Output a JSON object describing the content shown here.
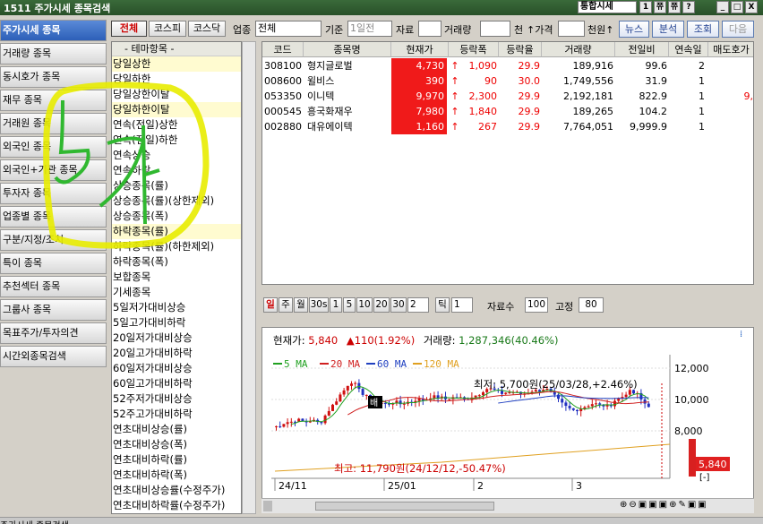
{
  "titlebar": {
    "title": "1511 주가시세 종목검색",
    "combo": "통합시세",
    "b1": "1",
    "b2": "쮸",
    "b3": "?",
    "b4": "_",
    "b5": "□",
    "b6": "X"
  },
  "leftmenu": [
    "주가시세 종목",
    "거래량 종목",
    "동시호가 종목",
    "재무 종목",
    "거래원 종목",
    "외국인 종목",
    "외국인+기관 종목",
    "투자자 종목",
    "업종별 종목",
    "구분/지정/조치",
    "특이 종목",
    "추천섹터 종목",
    "그룹사 종목",
    "목표주가/투자의견",
    "시간외종목검색"
  ],
  "toolbar": {
    "market_all": "전체",
    "kospi": "코스피",
    "kosdaq": "코스닥",
    "sector_label": "업종",
    "sector_value": "전체",
    "base_label": "기준",
    "base_value": "1일전",
    "data_label": "자료",
    "volume_label": "거래량",
    "unit_thousand": "천",
    "price_label": "↑가격",
    "unit_won": "천원↑",
    "news": "뉴스",
    "analysis": "분석",
    "search": "조회",
    "next": "다음"
  },
  "themes": {
    "header": "-   테마항목   -",
    "items": [
      "당일상한",
      "당일하한",
      "당일상한이탈",
      "당일하한이탈",
      "연속(전일)상한",
      "연속(전일)하한",
      "연속상승",
      "연속하락",
      "상승종목(률)",
      "상승종목(률)(상한제외)",
      "상승종목(폭)",
      "하락종목(률)",
      "하락종목(률)(하한제외)",
      "하락종목(폭)",
      "보합종목",
      "기세종목",
      "5일저가대비상승",
      "5일고가대비하락",
      "20일저가대비상승",
      "20일고가대비하락",
      "60일저가대비상승",
      "60일고가대비하락",
      "52주저가대비상승",
      "52주고가대비하락",
      "연초대비상승(률)",
      "연초대비상승(폭)",
      "연초대비하락(률)",
      "연초대비하락(폭)",
      "연초대비상승률(수정주가)",
      "연초대비하락률(수정주가)"
    ]
  },
  "grid": {
    "headers": [
      "코드",
      "종목명",
      "현재가",
      "등락폭",
      "등락율",
      "거래량",
      "전일비",
      "연속일",
      "매도호가"
    ],
    "rows": [
      [
        "308100",
        "형지글로벌",
        "4,730",
        "↑",
        "1,090",
        "29.9",
        "189,916",
        "99.6",
        "2",
        ""
      ],
      [
        "008600",
        "윌비스",
        "390",
        "↑",
        "90",
        "30.0",
        "1,749,556",
        "31.9",
        "1",
        ""
      ],
      [
        "053350",
        "이니텍",
        "9,970",
        "↑",
        "2,300",
        "29.9",
        "2,192,181",
        "822.9",
        "1",
        "9,"
      ],
      [
        "000545",
        "흥국화재우",
        "7,980",
        "↑",
        "1,840",
        "29.9",
        "189,265",
        "104.2",
        "1",
        ""
      ],
      [
        "002880",
        "대유에이텍",
        "1,160",
        "↑",
        "267",
        "29.9",
        "7,764,051",
        "9,999.9",
        "1",
        ""
      ]
    ]
  },
  "chartbar": {
    "periods": [
      "일",
      "주",
      "월",
      "30s",
      "1",
      "5",
      "10",
      "20",
      "30"
    ],
    "period_input": "2",
    "tick_label": "틱",
    "tick_value": "1",
    "count_label": "자료수",
    "count_value": "100",
    "fixed_label": "고정",
    "fixed_value": "80"
  },
  "chart": {
    "current_label": "현재가:",
    "current_value": "5,840",
    "change": "▲110(1.92%)",
    "volume_label": "거래량:",
    "volume_value": "1,287,346(40.46%)",
    "ma": [
      "5 MA",
      "20 MA",
      "60 MA",
      "120 MA"
    ],
    "ma_colors": [
      "#20a020",
      "#d02020",
      "#2040c0",
      "#e0a020"
    ],
    "low_note": "최저: 5,700원(25/03/28,+2.46%)",
    "high_note": "최고: 11,790원(24/12/12,-50.47%)",
    "marker": "배",
    "price_tag": "5,840",
    "y_ticks": [
      "12,000",
      "10,000",
      "8,000"
    ],
    "x_ticks": [
      "24/11",
      "25/01",
      "2",
      "3"
    ],
    "extra_tag": "[-]"
  },
  "annotation": {
    "text": "5개",
    "color": "#e8f000"
  },
  "status": "주가시세  종목검색"
}
